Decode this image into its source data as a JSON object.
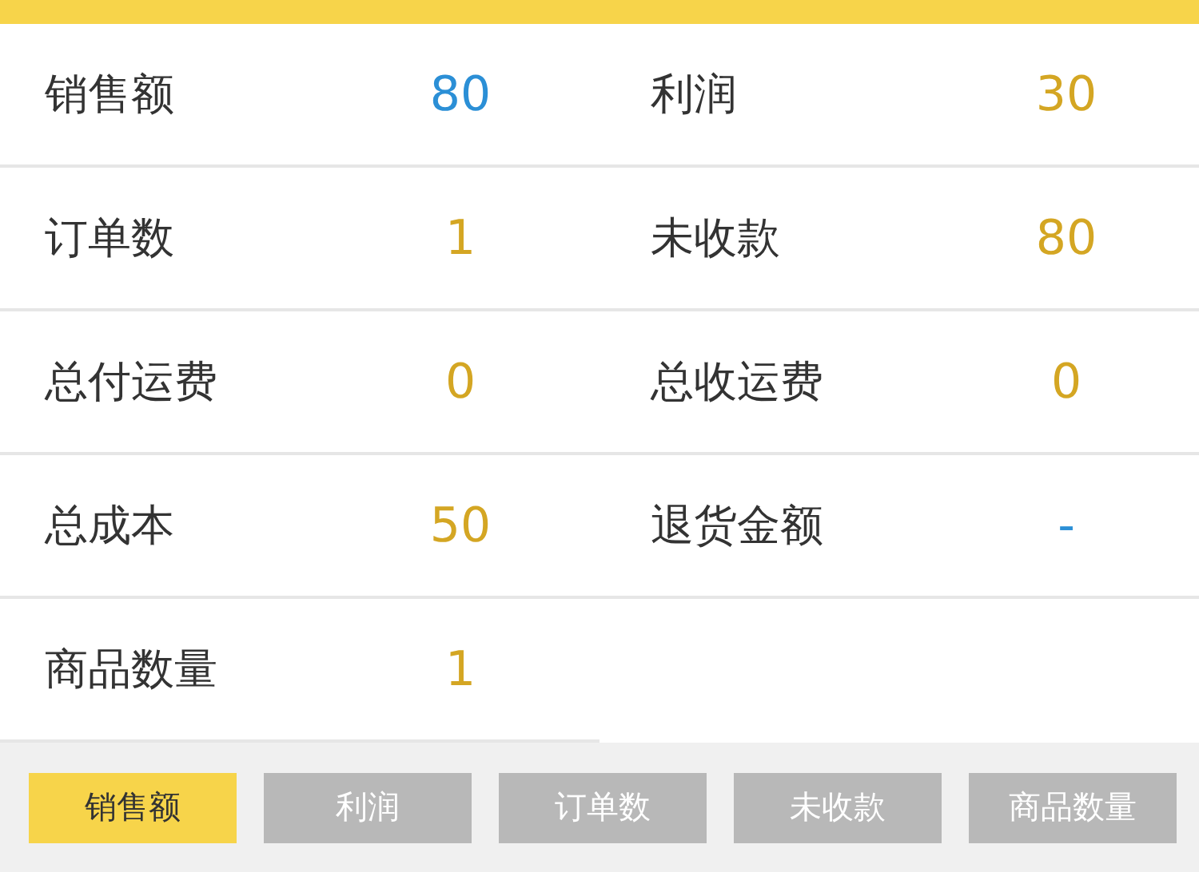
{
  "stats": [
    {
      "label": "销售额",
      "value": "80",
      "color": "#2b8fd6"
    },
    {
      "label": "利润",
      "value": "30",
      "color": "#d4a623"
    },
    {
      "label": "订单数",
      "value": "1",
      "color": "#d4a623"
    },
    {
      "label": "未收款",
      "value": "80",
      "color": "#d4a623"
    },
    {
      "label": "总付运费",
      "value": "0",
      "color": "#d4a623"
    },
    {
      "label": "总收运费",
      "value": "0",
      "color": "#d4a623"
    },
    {
      "label": "总成本",
      "value": "50",
      "color": "#d4a623"
    },
    {
      "label": "退货金额",
      "value": "-",
      "color": "#2b8fd6"
    },
    {
      "label": "商品数量",
      "value": "1",
      "color": "#d4a623"
    }
  ],
  "tabs": [
    {
      "label": "销售额",
      "selected": true
    },
    {
      "label": "利润",
      "selected": false
    },
    {
      "label": "订单数",
      "selected": false
    },
    {
      "label": "未收款",
      "selected": false
    },
    {
      "label": "商品数量",
      "selected": false
    }
  ]
}
